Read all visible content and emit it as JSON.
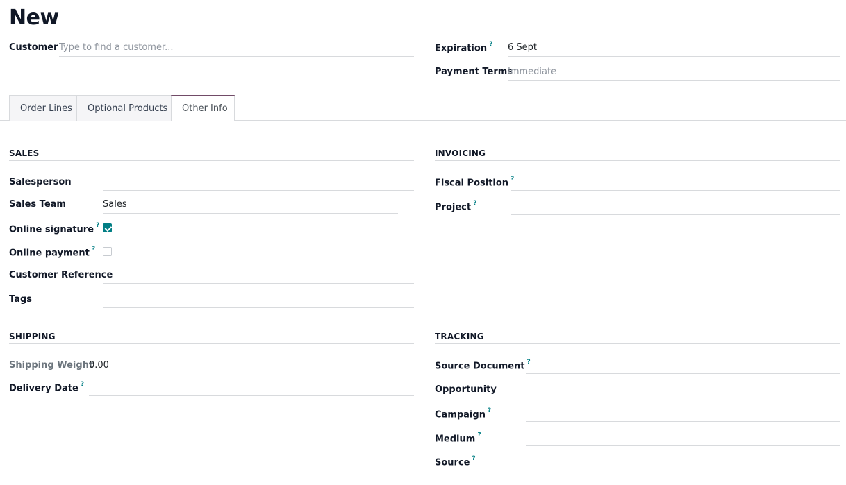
{
  "page": {
    "title": "New"
  },
  "header": {
    "customer": {
      "label": "Customer",
      "placeholder": "Type to find a customer..."
    },
    "expiration": {
      "label": "Expiration",
      "help": "?",
      "value": "6 Sept"
    },
    "payment_terms": {
      "label": "Payment Terms",
      "placeholder": "Immediate"
    }
  },
  "tabs": [
    {
      "label": "Order Lines",
      "active": false
    },
    {
      "label": "Optional Products",
      "active": false
    },
    {
      "label": "Other Info",
      "active": true
    }
  ],
  "sales": {
    "title": "SALES",
    "salesperson": {
      "label": "Salesperson",
      "value": ""
    },
    "sales_team": {
      "label": "Sales Team",
      "value": "Sales"
    },
    "online_signature": {
      "label": "Online signature",
      "help": "?",
      "checked": true
    },
    "online_payment": {
      "label": "Online payment",
      "help": "?",
      "checked": false
    },
    "customer_reference": {
      "label": "Customer Reference",
      "value": ""
    },
    "tags": {
      "label": "Tags",
      "value": ""
    }
  },
  "invoicing": {
    "title": "INVOICING",
    "fiscal_position": {
      "label": "Fiscal Position",
      "help": "?",
      "value": ""
    },
    "project": {
      "label": "Project",
      "help": "?",
      "value": ""
    }
  },
  "shipping": {
    "title": "SHIPPING",
    "shipping_weight": {
      "label": "Shipping Weight",
      "value": "0.00"
    },
    "delivery_date": {
      "label": "Delivery Date",
      "help": "?",
      "value": ""
    }
  },
  "tracking": {
    "title": "TRACKING",
    "source_document": {
      "label": "Source Document",
      "help": "?",
      "value": ""
    },
    "opportunity": {
      "label": "Opportunity",
      "value": ""
    },
    "campaign": {
      "label": "Campaign",
      "help": "?",
      "value": ""
    },
    "medium": {
      "label": "Medium",
      "help": "?",
      "value": ""
    },
    "source": {
      "label": "Source",
      "help": "?",
      "value": ""
    }
  },
  "colors": {
    "accent": "#017e84",
    "tab_active_border": "#714b67",
    "border": "#d8dadd",
    "placeholder": "#8f959e"
  }
}
